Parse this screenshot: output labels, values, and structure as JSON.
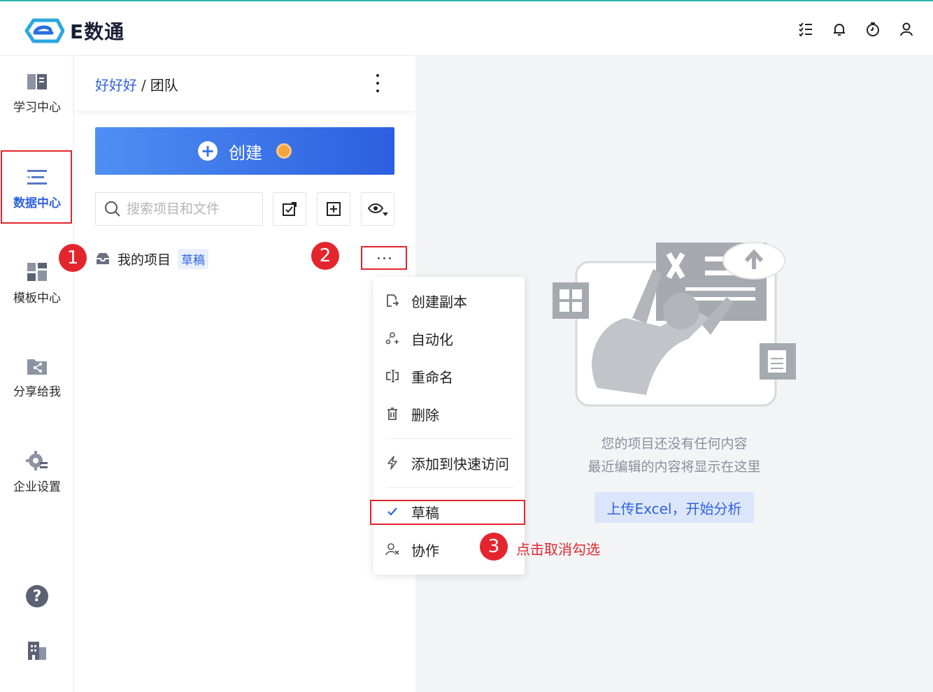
{
  "app": {
    "logo_text": "E数通"
  },
  "topbar": {
    "icons": [
      "task-list-icon",
      "bell-icon",
      "timer-icon",
      "user-icon"
    ]
  },
  "nav": {
    "items": [
      {
        "label": "学习中心",
        "icon": "book-icon"
      },
      {
        "label": "数据中心",
        "icon": "data-list-icon",
        "active": true
      },
      {
        "label": "模板中心",
        "icon": "template-grid-icon"
      },
      {
        "label": "分享给我",
        "icon": "share-folder-icon"
      },
      {
        "label": "企业设置",
        "icon": "gear-icon"
      }
    ],
    "bottom_icons": [
      "help-icon",
      "building-icon"
    ]
  },
  "breadcrumb": {
    "parent": "好好好",
    "separator": "/",
    "current": "团队"
  },
  "create_button": {
    "label": "创建"
  },
  "search": {
    "placeholder": "搜索项目和文件"
  },
  "project": {
    "name": "我的项目",
    "badge": "草稿"
  },
  "context_menu": {
    "items": [
      "创建副本",
      "自动化",
      "重命名",
      "删除",
      "添加到快速访问",
      "草稿",
      "协作"
    ],
    "checked": "草稿"
  },
  "steps": [
    "1",
    "2",
    "3"
  ],
  "annotation": "点击取消勾选",
  "empty_state": {
    "line1": "您的项目还没有任何内容",
    "line2": "最近编辑的内容将显示在这里",
    "upload_label": "上传Excel，开始分析"
  },
  "colors": {
    "accent": "#2f62e0",
    "highlight": "#e3262d",
    "top_border": "#2fb3b0"
  }
}
